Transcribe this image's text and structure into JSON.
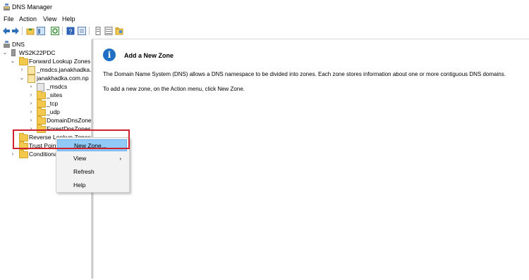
{
  "window": {
    "title": "DNS Manager"
  },
  "menu": [
    "File",
    "Action",
    "View",
    "Help"
  ],
  "toolbar": [
    "back",
    "forward",
    "up-folder",
    "show-hide-tree",
    "refresh",
    "help",
    "properties",
    "list",
    "details",
    "folder"
  ],
  "tree": {
    "root": "DNS",
    "server": "WS2K22PDC",
    "forward_zones": "Forward Lookup Zones",
    "msdcs_zone": "_msdcs.janakhadka.c",
    "zone": "janakhadka.com.np",
    "children": [
      "_msdcs",
      "_sites",
      "_tcp",
      "_udp",
      "DomainDnsZones",
      "ForestDnsZones"
    ],
    "reverse_zones": "Reverse Lookup Zones",
    "trust_points": "Trust Point",
    "conditional": "Conditiona"
  },
  "content": {
    "heading": "Add a New Zone",
    "description": "The Domain Name System (DNS) allows a DNS namespace to be divided into zones. Each zone stores information about one or more contiguous DNS domains.",
    "instruction": "To add a new zone, on the Action menu, click New Zone."
  },
  "context_menu": {
    "items": [
      "New Zone...",
      "View",
      "Refresh",
      "Help"
    ],
    "selected": "New Zone...",
    "submenu_arrow": "›"
  },
  "colors": {
    "highlight": "#d0212e",
    "selection": "#91c9f7",
    "info_icon": "#1f6fc5",
    "folder": "#f2c94c"
  }
}
